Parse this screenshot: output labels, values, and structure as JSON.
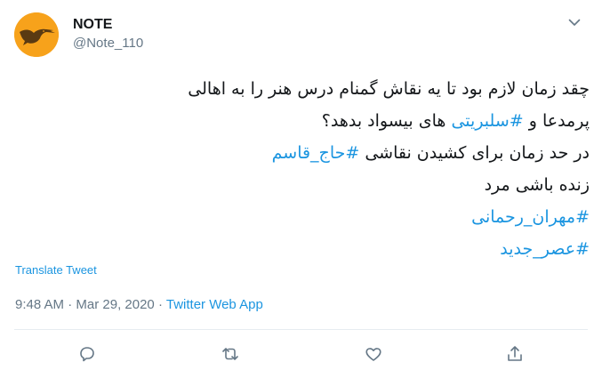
{
  "tweet": {
    "author": {
      "display_name": "NOTE",
      "handle": "@Note_110",
      "avatar_icon": "bird-silhouette-icon"
    },
    "text_lines": [
      [
        {
          "t": "چقد زمان لازم بود تا یه نقاش گمنام درس هنر را به اهالی",
          "tag": false
        }
      ],
      [
        {
          "t": "پرمدعا و ",
          "tag": false
        },
        {
          "t": "#سلبریتی",
          "tag": true
        },
        {
          "t": " های بیسواد بدهد؟",
          "tag": false
        }
      ],
      [
        {
          "t": "در حد زمان برای کشیدن نقاشی ",
          "tag": false
        },
        {
          "t": "#حاج_قاسم",
          "tag": true
        }
      ],
      [
        {
          "t": "زنده باشی مرد",
          "tag": false
        }
      ],
      [
        {
          "t": "#مهران_رحمانی",
          "tag": true
        }
      ],
      [
        {
          "t": "#عصر_جدید",
          "tag": true
        }
      ]
    ],
    "translate_label": "Translate Tweet",
    "time": "9:48 AM",
    "date": "Mar 29, 2020",
    "separator": "·",
    "source": "Twitter Web App",
    "actions": [
      {
        "name": "reply",
        "icon": "reply-icon"
      },
      {
        "name": "retweet",
        "icon": "retweet-icon"
      },
      {
        "name": "like",
        "icon": "heart-icon"
      },
      {
        "name": "share",
        "icon": "share-icon"
      }
    ]
  },
  "colors": {
    "link": "#1b95e0",
    "muted": "#657786",
    "text": "#14171a",
    "avatar_bg": "#f7a21b",
    "divider": "#e6ecf0"
  }
}
